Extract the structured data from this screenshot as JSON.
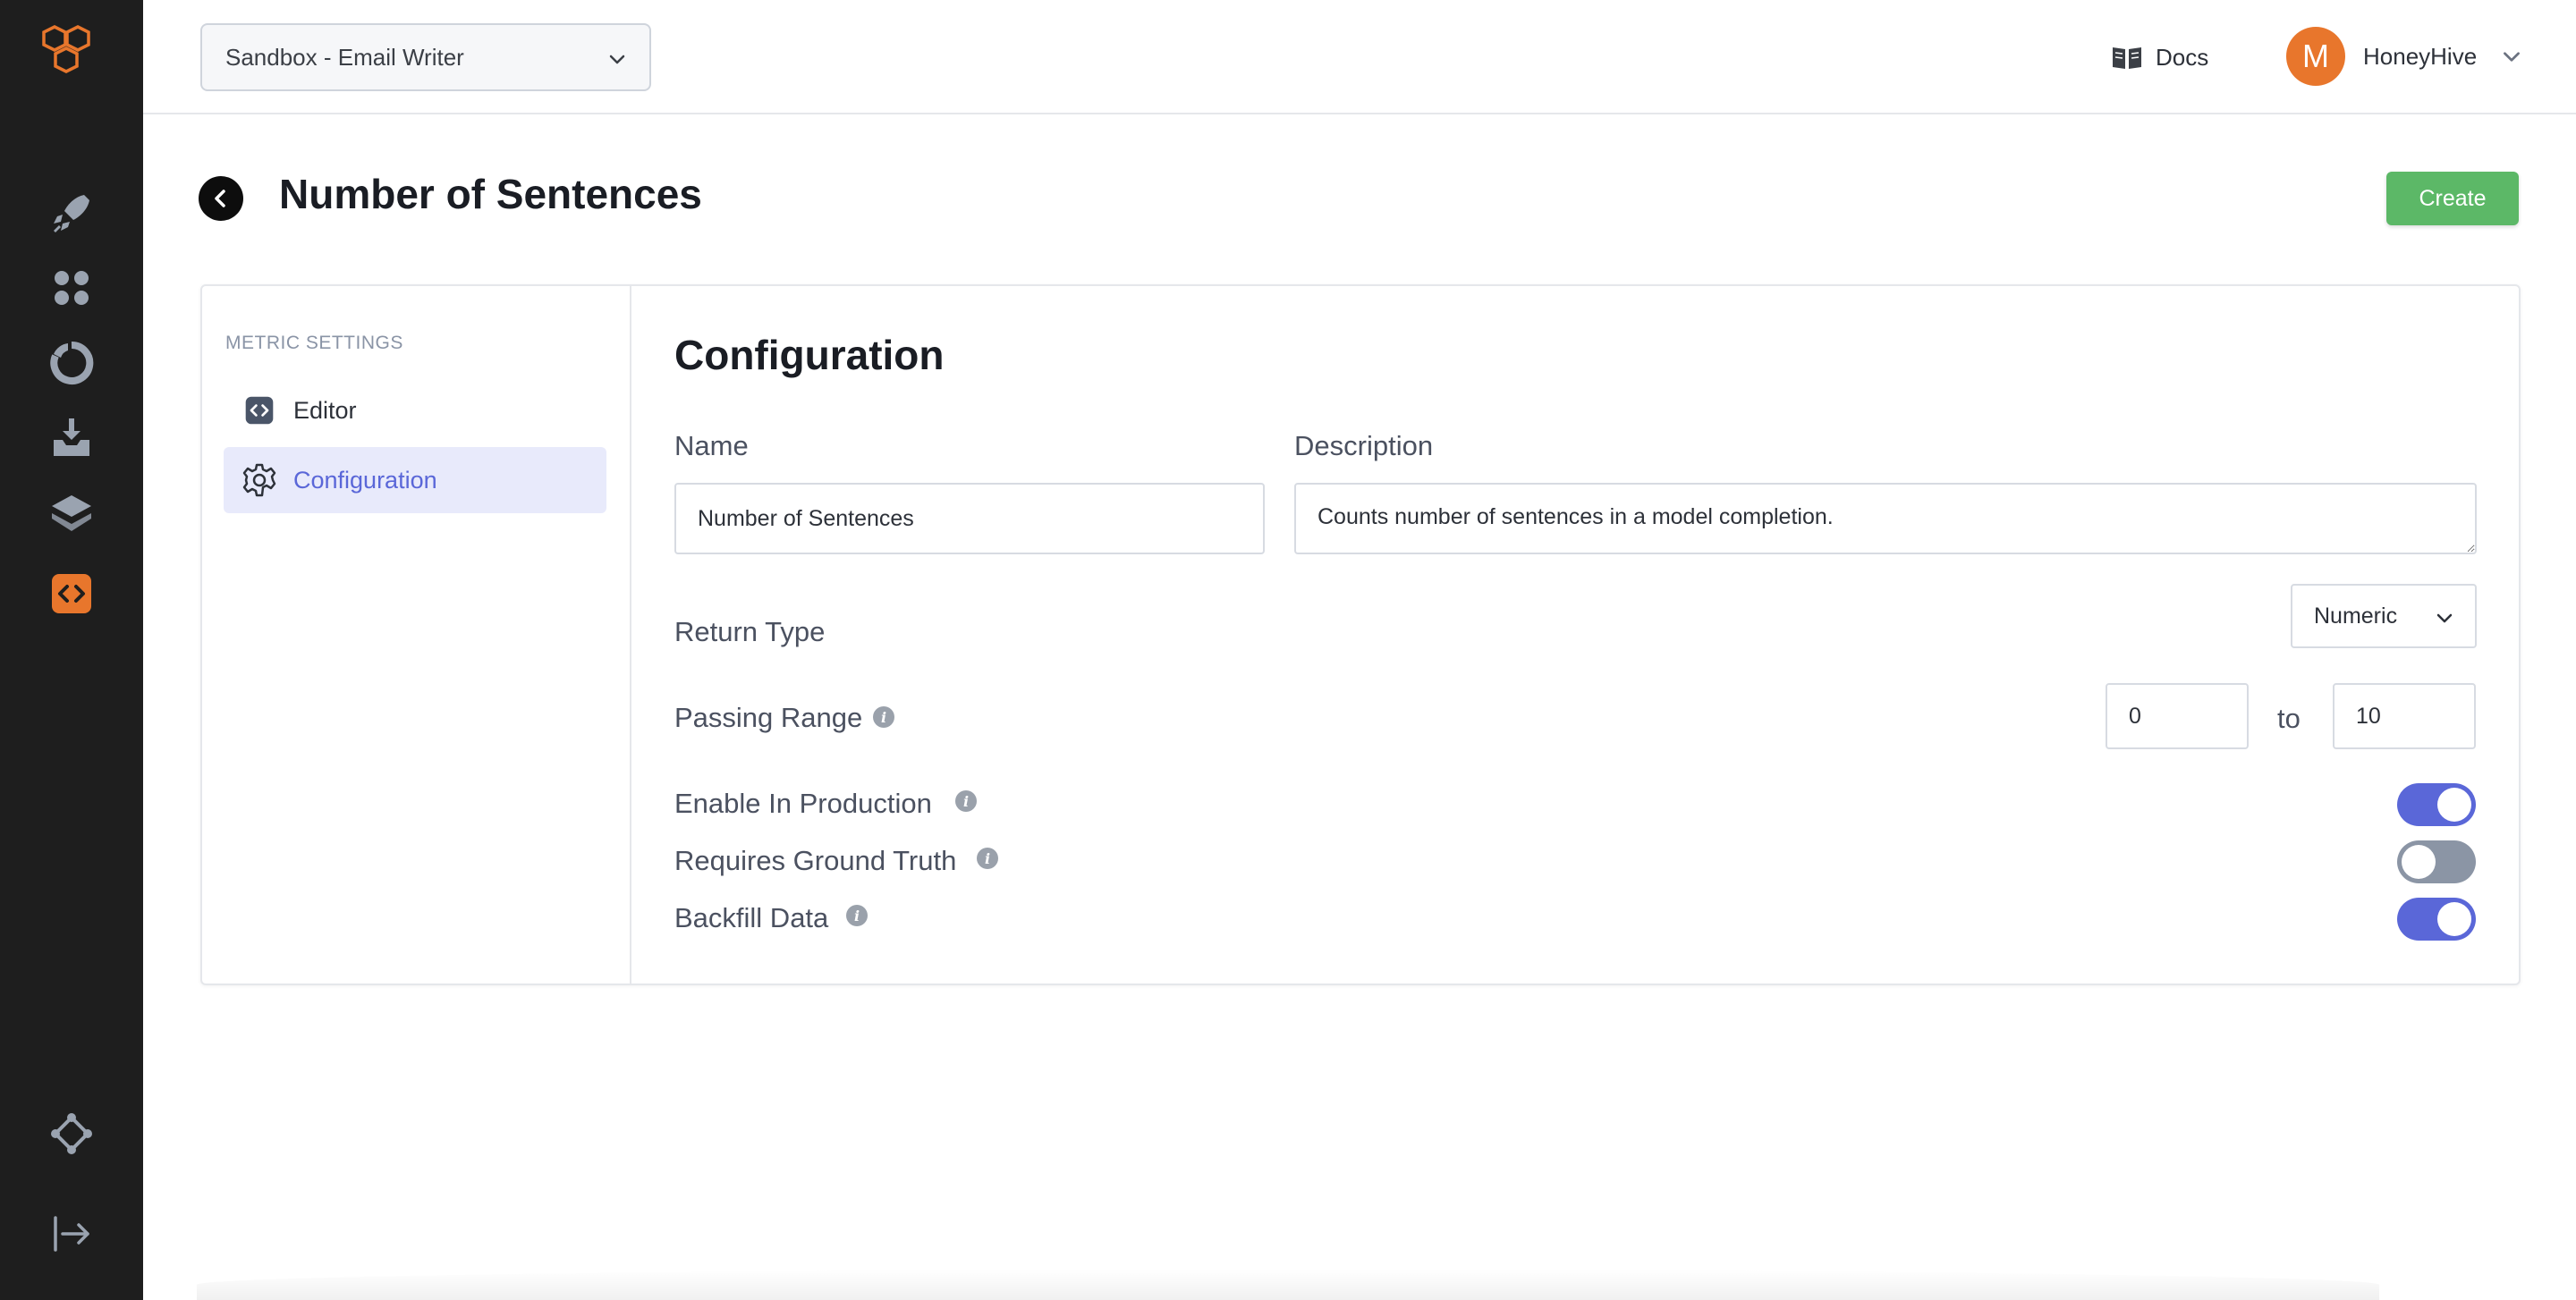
{
  "topbar": {
    "project_select_value": "Sandbox - Email Writer",
    "docs_label": "Docs",
    "user_initial": "M",
    "user_name": "HoneyHive"
  },
  "rail": {
    "icons": [
      "rocket-icon",
      "grid-dots-icon",
      "donut-chart-icon",
      "inbox-download-icon",
      "layers-icon",
      "code-icon",
      "network-icon",
      "logout-icon"
    ],
    "active_icon": "code-icon",
    "accent_color": "#e8762c"
  },
  "header": {
    "title": "Number of Sentences",
    "create_label": "Create"
  },
  "sidebar": {
    "heading": "METRIC SETTINGS",
    "items": [
      {
        "label": "Editor",
        "icon": "code-icon"
      },
      {
        "label": "Configuration",
        "icon": "gear-icon",
        "active": true
      }
    ]
  },
  "config": {
    "title": "Configuration",
    "name_label": "Name",
    "name_value": "Number of Sentences",
    "description_label": "Description",
    "description_value": "Counts number of sentences in a model completion.",
    "return_type_label": "Return Type",
    "return_type_value": "Numeric",
    "passing_range_label": "Passing Range",
    "range_min": "0",
    "range_to": "to",
    "range_max": "10",
    "toggles": [
      {
        "label": "Enable In Production",
        "on": true
      },
      {
        "label": "Requires Ground Truth",
        "on": false
      },
      {
        "label": "Backfill Data",
        "on": true
      }
    ]
  },
  "colors": {
    "primary": "#5a67d8",
    "create_green": "#5cb867",
    "rail_bg": "#1e1e1e",
    "toggle_off": "#8b95a5"
  }
}
